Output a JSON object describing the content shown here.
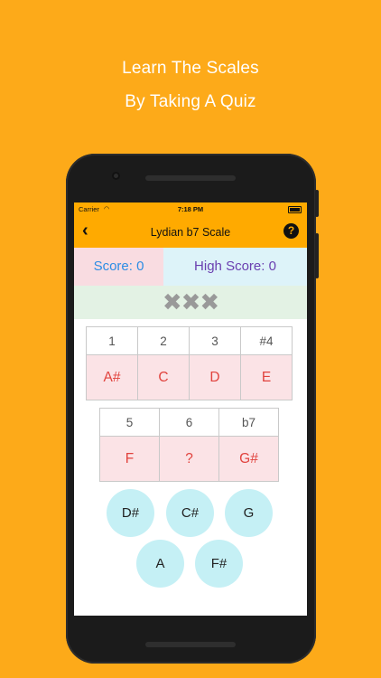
{
  "promo": {
    "line1": "Learn The Scales",
    "line2": "By Taking A Quiz"
  },
  "status_bar": {
    "carrier": "Carrier",
    "time": "7:18 PM"
  },
  "nav": {
    "back_icon": "chevron-left-icon",
    "title": "Lydian b7 Scale",
    "help_icon": "question-icon"
  },
  "score": {
    "score_text": "Score: 0",
    "high_score_text": "High Score: 0"
  },
  "strikes": {
    "text": "✖✖✖"
  },
  "scale_row_1": {
    "degrees": [
      "1",
      "2",
      "3",
      "#4"
    ],
    "notes": [
      "A#",
      "C",
      "D",
      "E"
    ]
  },
  "scale_row_2": {
    "degrees": [
      "5",
      "6",
      "b7"
    ],
    "notes": [
      "F",
      "?",
      "G#"
    ]
  },
  "choices": [
    "D#",
    "C#",
    "G",
    "A",
    "F#"
  ],
  "colors": {
    "background": "#FDAA19",
    "nav": "#FFAA00",
    "score_bg": "#F9DCE1",
    "score_text": "#2D8DE4",
    "high_score_bg": "#DDF3F9",
    "high_score_text": "#6A3FB0",
    "strikes_bg": "#E3F2E4",
    "note_text": "#E1433E",
    "note_bg": "#FBE3E6",
    "choice_bg": "#C5F0F5"
  }
}
